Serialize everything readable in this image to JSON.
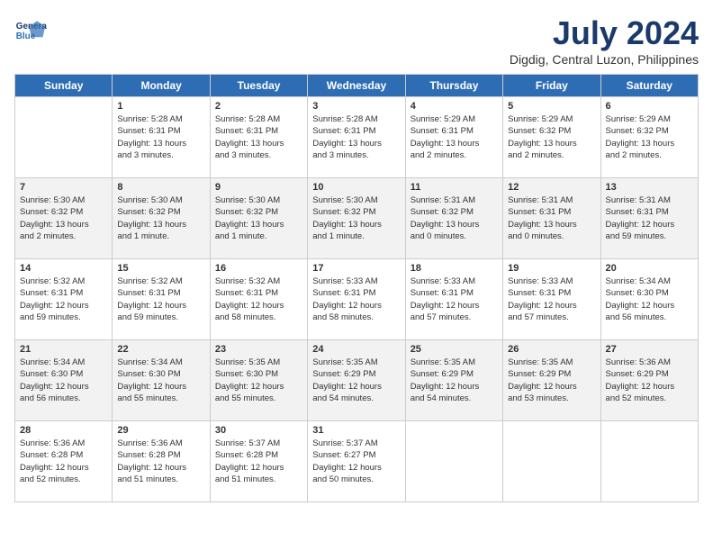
{
  "header": {
    "logo_line1": "General",
    "logo_line2": "Blue",
    "month_title": "July 2024",
    "location": "Digdig, Central Luzon, Philippines"
  },
  "days_of_week": [
    "Sunday",
    "Monday",
    "Tuesday",
    "Wednesday",
    "Thursday",
    "Friday",
    "Saturday"
  ],
  "weeks": [
    [
      {
        "day": "",
        "detail": ""
      },
      {
        "day": "1",
        "detail": "Sunrise: 5:28 AM\nSunset: 6:31 PM\nDaylight: 13 hours\nand 3 minutes."
      },
      {
        "day": "2",
        "detail": "Sunrise: 5:28 AM\nSunset: 6:31 PM\nDaylight: 13 hours\nand 3 minutes."
      },
      {
        "day": "3",
        "detail": "Sunrise: 5:28 AM\nSunset: 6:31 PM\nDaylight: 13 hours\nand 3 minutes."
      },
      {
        "day": "4",
        "detail": "Sunrise: 5:29 AM\nSunset: 6:31 PM\nDaylight: 13 hours\nand 2 minutes."
      },
      {
        "day": "5",
        "detail": "Sunrise: 5:29 AM\nSunset: 6:32 PM\nDaylight: 13 hours\nand 2 minutes."
      },
      {
        "day": "6",
        "detail": "Sunrise: 5:29 AM\nSunset: 6:32 PM\nDaylight: 13 hours\nand 2 minutes."
      }
    ],
    [
      {
        "day": "7",
        "detail": "Sunrise: 5:30 AM\nSunset: 6:32 PM\nDaylight: 13 hours\nand 2 minutes."
      },
      {
        "day": "8",
        "detail": "Sunrise: 5:30 AM\nSunset: 6:32 PM\nDaylight: 13 hours\nand 1 minute."
      },
      {
        "day": "9",
        "detail": "Sunrise: 5:30 AM\nSunset: 6:32 PM\nDaylight: 13 hours\nand 1 minute."
      },
      {
        "day": "10",
        "detail": "Sunrise: 5:30 AM\nSunset: 6:32 PM\nDaylight: 13 hours\nand 1 minute."
      },
      {
        "day": "11",
        "detail": "Sunrise: 5:31 AM\nSunset: 6:32 PM\nDaylight: 13 hours\nand 0 minutes."
      },
      {
        "day": "12",
        "detail": "Sunrise: 5:31 AM\nSunset: 6:31 PM\nDaylight: 13 hours\nand 0 minutes."
      },
      {
        "day": "13",
        "detail": "Sunrise: 5:31 AM\nSunset: 6:31 PM\nDaylight: 12 hours\nand 59 minutes."
      }
    ],
    [
      {
        "day": "14",
        "detail": "Sunrise: 5:32 AM\nSunset: 6:31 PM\nDaylight: 12 hours\nand 59 minutes."
      },
      {
        "day": "15",
        "detail": "Sunrise: 5:32 AM\nSunset: 6:31 PM\nDaylight: 12 hours\nand 59 minutes."
      },
      {
        "day": "16",
        "detail": "Sunrise: 5:32 AM\nSunset: 6:31 PM\nDaylight: 12 hours\nand 58 minutes."
      },
      {
        "day": "17",
        "detail": "Sunrise: 5:33 AM\nSunset: 6:31 PM\nDaylight: 12 hours\nand 58 minutes."
      },
      {
        "day": "18",
        "detail": "Sunrise: 5:33 AM\nSunset: 6:31 PM\nDaylight: 12 hours\nand 57 minutes."
      },
      {
        "day": "19",
        "detail": "Sunrise: 5:33 AM\nSunset: 6:31 PM\nDaylight: 12 hours\nand 57 minutes."
      },
      {
        "day": "20",
        "detail": "Sunrise: 5:34 AM\nSunset: 6:30 PM\nDaylight: 12 hours\nand 56 minutes."
      }
    ],
    [
      {
        "day": "21",
        "detail": "Sunrise: 5:34 AM\nSunset: 6:30 PM\nDaylight: 12 hours\nand 56 minutes."
      },
      {
        "day": "22",
        "detail": "Sunrise: 5:34 AM\nSunset: 6:30 PM\nDaylight: 12 hours\nand 55 minutes."
      },
      {
        "day": "23",
        "detail": "Sunrise: 5:35 AM\nSunset: 6:30 PM\nDaylight: 12 hours\nand 55 minutes."
      },
      {
        "day": "24",
        "detail": "Sunrise: 5:35 AM\nSunset: 6:29 PM\nDaylight: 12 hours\nand 54 minutes."
      },
      {
        "day": "25",
        "detail": "Sunrise: 5:35 AM\nSunset: 6:29 PM\nDaylight: 12 hours\nand 54 minutes."
      },
      {
        "day": "26",
        "detail": "Sunrise: 5:35 AM\nSunset: 6:29 PM\nDaylight: 12 hours\nand 53 minutes."
      },
      {
        "day": "27",
        "detail": "Sunrise: 5:36 AM\nSunset: 6:29 PM\nDaylight: 12 hours\nand 52 minutes."
      }
    ],
    [
      {
        "day": "28",
        "detail": "Sunrise: 5:36 AM\nSunset: 6:28 PM\nDaylight: 12 hours\nand 52 minutes."
      },
      {
        "day": "29",
        "detail": "Sunrise: 5:36 AM\nSunset: 6:28 PM\nDaylight: 12 hours\nand 51 minutes."
      },
      {
        "day": "30",
        "detail": "Sunrise: 5:37 AM\nSunset: 6:28 PM\nDaylight: 12 hours\nand 51 minutes."
      },
      {
        "day": "31",
        "detail": "Sunrise: 5:37 AM\nSunset: 6:27 PM\nDaylight: 12 hours\nand 50 minutes."
      },
      {
        "day": "",
        "detail": ""
      },
      {
        "day": "",
        "detail": ""
      },
      {
        "day": "",
        "detail": ""
      }
    ]
  ]
}
